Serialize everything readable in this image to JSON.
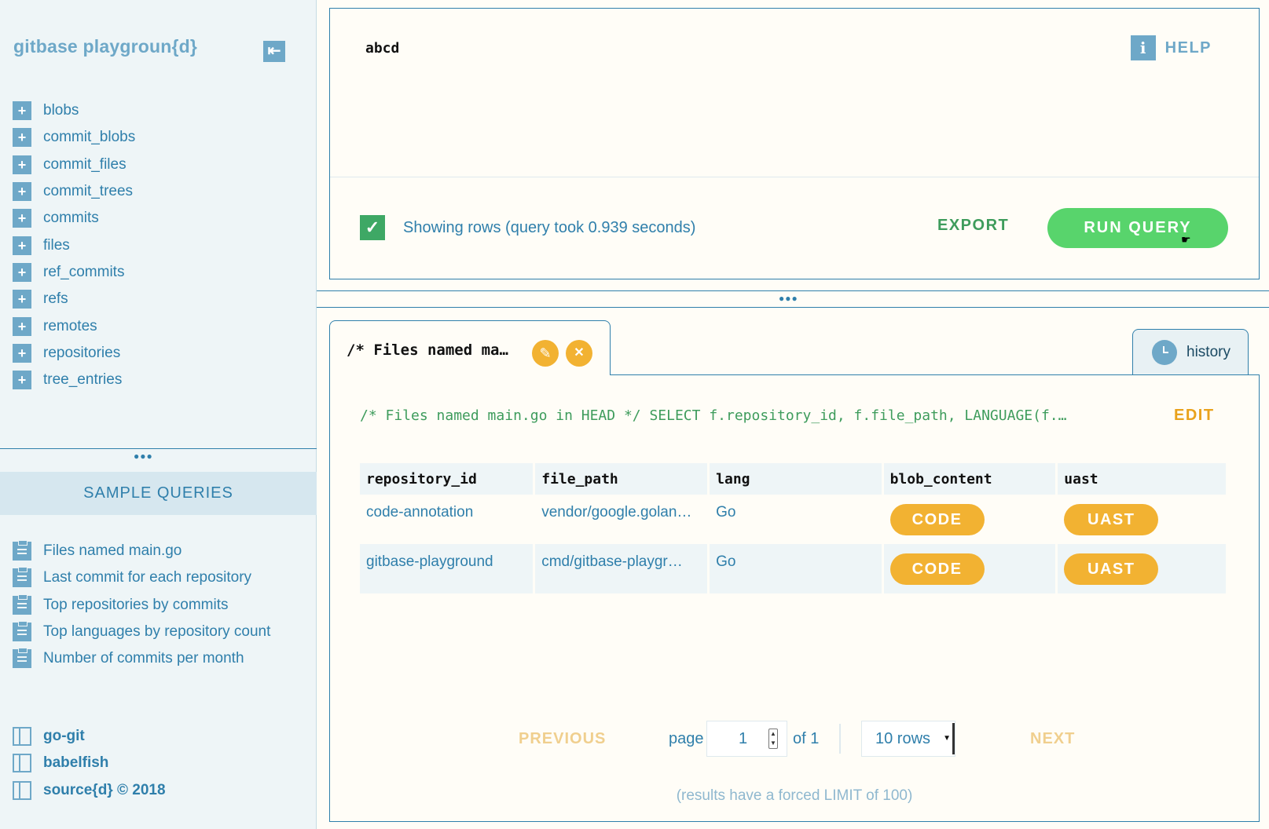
{
  "sidebar": {
    "title": "gitbase playgroun{d}",
    "collapse_icon": "arrow-left-icon",
    "tables": [
      "blobs",
      "commit_blobs",
      "commit_files",
      "commit_trees",
      "commits",
      "files",
      "ref_commits",
      "refs",
      "remotes",
      "repositories",
      "tree_entries"
    ],
    "sample_header": "SAMPLE QUERIES",
    "samples": [
      "Files named main.go",
      "Last commit for each repository",
      "Top repositories by commits",
      "Top languages by repository count",
      "Number of commits per month"
    ],
    "links": [
      "go-git",
      "babelfish",
      "source{d} © 2018"
    ]
  },
  "editor": {
    "query": "abcd",
    "help_label": "HELP",
    "status_text": "Showing rows (query took 0.939 seconds)",
    "export_label": "EXPORT",
    "run_label": "RUN QUERY"
  },
  "tabs": {
    "active_title": "/* Files named ma…",
    "history_label": "history"
  },
  "results": {
    "sql": "/* Files named main.go in HEAD */ SELECT f.repository_id, f.file_path, LANGUAGE(f.…",
    "edit_label": "EDIT",
    "columns": [
      "repository_id",
      "file_path",
      "lang",
      "blob_content",
      "uast"
    ],
    "rows": [
      {
        "repository_id": "code-annotation",
        "file_path": "vendor/google.golan…",
        "lang": "Go",
        "blob_content": "CODE",
        "uast": "UAST"
      },
      {
        "repository_id": "gitbase-playground",
        "file_path": "cmd/gitbase-playgr…",
        "lang": "Go",
        "blob_content": "CODE",
        "uast": "UAST"
      }
    ],
    "pager": {
      "prev_label": "PREVIOUS",
      "page_label": "page",
      "page_value": "1",
      "of_label": "of 1",
      "rows_value": "10 rows",
      "next_label": "NEXT"
    },
    "limit_note": "(results have a forced LIMIT of 100)"
  },
  "colors": {
    "accent": "#2f7fab",
    "run_button": "#58d46c",
    "pill": "#f2b232",
    "success": "#3ea865"
  }
}
